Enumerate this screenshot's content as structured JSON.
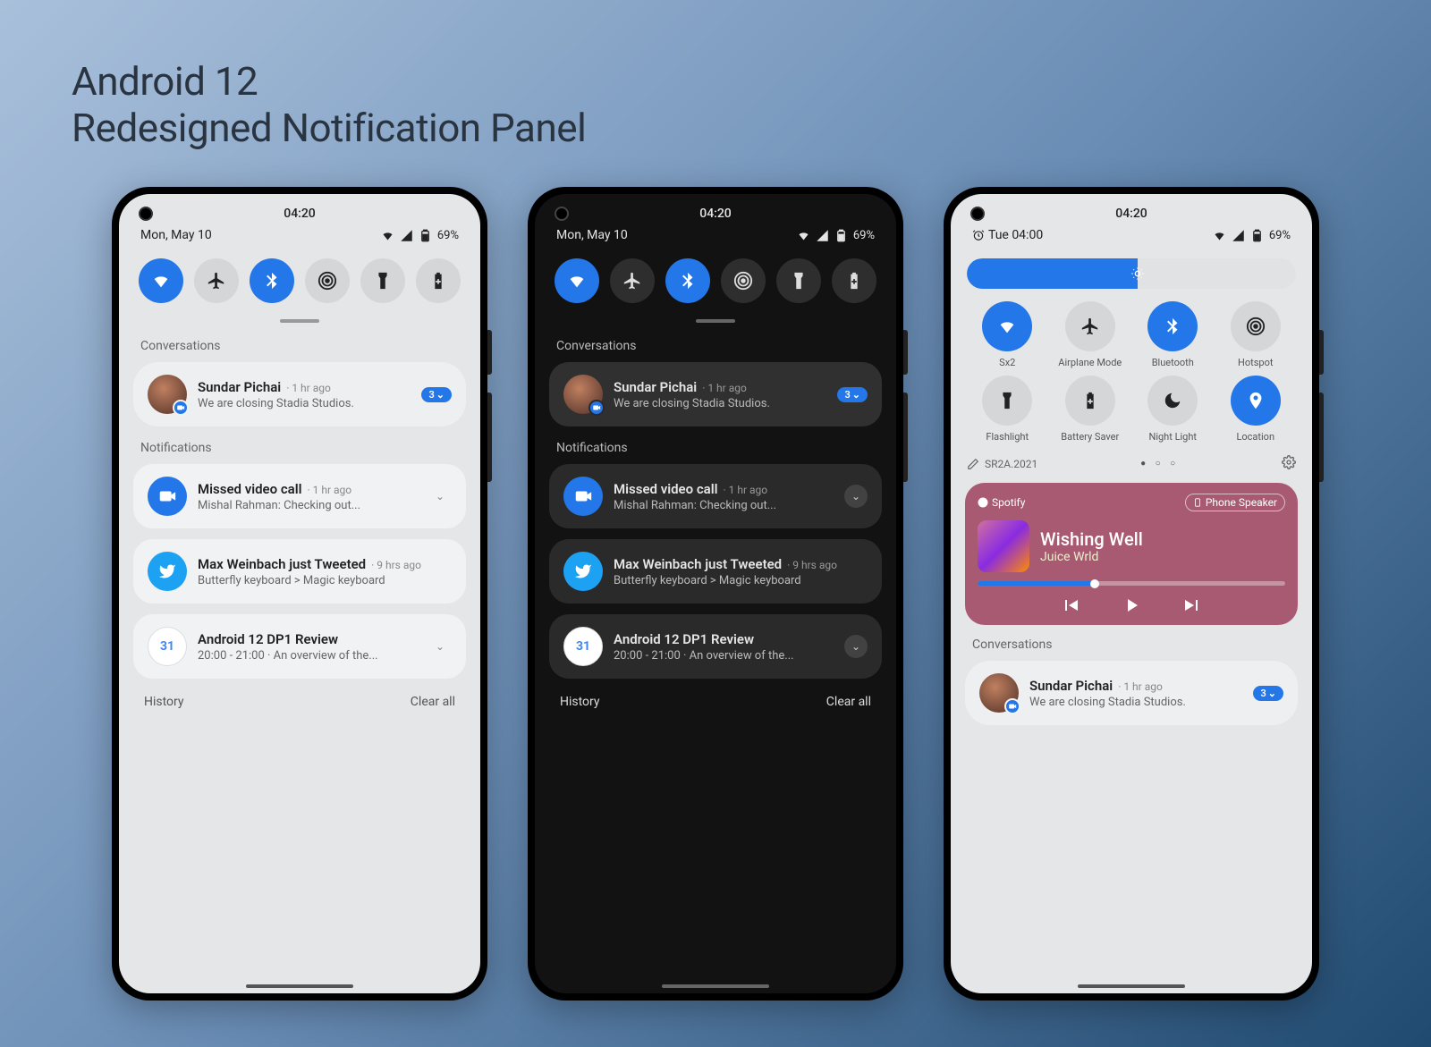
{
  "header": {
    "line1": "Android 12",
    "line2": "Redesigned Notification Panel"
  },
  "status": {
    "time": "04:20",
    "date_light": "Mon, May 10",
    "alarm_date": "Tue 04:00",
    "battery": "69%"
  },
  "qs_toggles": [
    {
      "name": "wifi",
      "active": true
    },
    {
      "name": "airplane",
      "active": false
    },
    {
      "name": "bluetooth",
      "active": true
    },
    {
      "name": "hotspot",
      "active": false
    },
    {
      "name": "flashlight",
      "active": false
    },
    {
      "name": "battery-saver",
      "active": false
    }
  ],
  "qs_tiles": [
    {
      "name": "wifi",
      "label": "Sx2",
      "active": true
    },
    {
      "name": "airplane",
      "label": "Airplane Mode",
      "active": false
    },
    {
      "name": "bluetooth",
      "label": "Bluetooth",
      "active": true
    },
    {
      "name": "hotspot",
      "label": "Hotspot",
      "active": false
    },
    {
      "name": "flashlight",
      "label": "Flashlight",
      "active": false
    },
    {
      "name": "battery-saver",
      "label": "Battery Saver",
      "active": false
    },
    {
      "name": "night-light",
      "label": "Night Light",
      "active": false
    },
    {
      "name": "location",
      "label": "Location",
      "active": true
    }
  ],
  "sections": {
    "conversations": "Conversations",
    "notifications": "Notifications"
  },
  "convo": {
    "name": "Sundar Pichai",
    "meta": "1 hr ago",
    "text": "We are closing Stadia Studios.",
    "badge": "3"
  },
  "notifs": [
    {
      "title": "Missed video call",
      "meta": "1 hr ago",
      "text": "Mishal Rahman: Checking out...",
      "icon": "video"
    },
    {
      "title": "Max Weinbach just Tweeted",
      "meta": "9 hrs ago",
      "text": "Butterfly keyboard > Magic keyboard",
      "icon": "twitter"
    },
    {
      "title": "Android 12 DP1 Review",
      "meta": "",
      "text": "20:00 - 21:00  ·  An overview of the...",
      "icon": "calendar"
    }
  ],
  "footer": {
    "history": "History",
    "clear_all": "Clear all"
  },
  "build": {
    "label": "SR2A.2021"
  },
  "media": {
    "app": "Spotify",
    "output": "Phone Speaker",
    "title": "Wishing Well",
    "artist": "Juice Wrld"
  }
}
